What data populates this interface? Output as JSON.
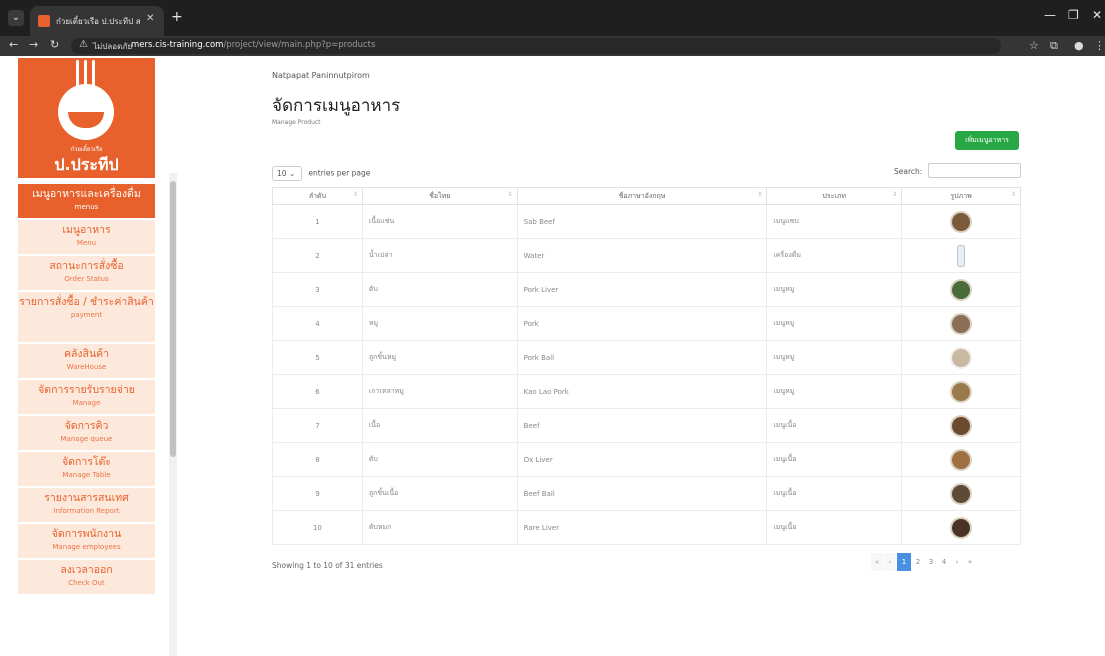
{
  "browser": {
    "tab_title": "ก๋วยเตี๋ยวเรือ ป.ประทีป สาขาเจ้ยยอด",
    "address_label": "ไม่ปลอดภัย",
    "url_host": "mers.cis-training.com",
    "url_path": "/project/view/main.php?p=products"
  },
  "logo": {
    "small": "ก๋วยเตี๋ยวเรือ",
    "name": "ป.ประทีป"
  },
  "sidebar": {
    "items": [
      {
        "th": "เมนูอาหารและเครื่องดื่ม",
        "en": "menus"
      },
      {
        "th": "เมนูอาหาร",
        "en": "Menu"
      },
      {
        "th": "สถานะการสั่งซื้อ",
        "en": "Order Status"
      },
      {
        "th": "รายการสั่งซื้อ / ชำระค่าสินค้า",
        "en": "payment"
      },
      {
        "th": "คลังสินค้า",
        "en": "WareHouse"
      },
      {
        "th": "จัดการรายรับรายจ่าย",
        "en": "Manage"
      },
      {
        "th": "จัดการคิว",
        "en": "Manage queue"
      },
      {
        "th": "จัดการโต๊ะ",
        "en": "Manage Table"
      },
      {
        "th": "รายงานสารสนเทศ",
        "en": "Information Report"
      },
      {
        "th": "จัดการพนักงาน",
        "en": "Manage employees"
      },
      {
        "th": "ลงเวลาออก",
        "en": "Check Out"
      }
    ]
  },
  "header": {
    "username": "Natpapat Paninnutpirom",
    "title": "จัดการเมนูอาหาร",
    "subtitle": "Manage Product",
    "add_button": "เพิ่มเมนูอาหาร"
  },
  "controls": {
    "entries_value": "10",
    "entries_label": "entries per page",
    "search_label": "Search:"
  },
  "table": {
    "headers": [
      "ลำดับ",
      "ชื่อไทย",
      "ชื่อภาษาอังกฤษ",
      "ประเภท",
      "รูปภาพ"
    ],
    "rows": [
      {
        "no": "1",
        "th": "เนื้อแช่น",
        "en": "Sab Beef",
        "type": "เมนูแซบ"
      },
      {
        "no": "2",
        "th": "น้ำเปล่า",
        "en": "Water",
        "type": "เครื่องดื่ม"
      },
      {
        "no": "3",
        "th": "ตับ",
        "en": "Pork Liver",
        "type": "เมนูหมู"
      },
      {
        "no": "4",
        "th": "หมู",
        "en": "Pork",
        "type": "เมนูหมู"
      },
      {
        "no": "5",
        "th": "ลูกชิ้นหมู",
        "en": "Pork Ball",
        "type": "เมนูหมู"
      },
      {
        "no": "6",
        "th": "เกาเหลาหมู",
        "en": "Kao Lao Pork",
        "type": "เมนูหมู"
      },
      {
        "no": "7",
        "th": "เนื้อ",
        "en": "Beef",
        "type": "เมนูเนื้อ"
      },
      {
        "no": "8",
        "th": "ตับ",
        "en": "Ox Liver",
        "type": "เมนูเนื้อ"
      },
      {
        "no": "9",
        "th": "ลูกชิ้นเนื้อ",
        "en": "Beef Ball",
        "type": "เมนูเนื้อ"
      },
      {
        "no": "10",
        "th": "ตับหมก",
        "en": "Rare Liver",
        "type": "เมนูเนื้อ"
      }
    ]
  },
  "footer": {
    "info": "Showing 1 to 10 of 31 entries",
    "pages": [
      "«",
      "‹",
      "1",
      "2",
      "3",
      "4",
      "›",
      "»"
    ]
  }
}
